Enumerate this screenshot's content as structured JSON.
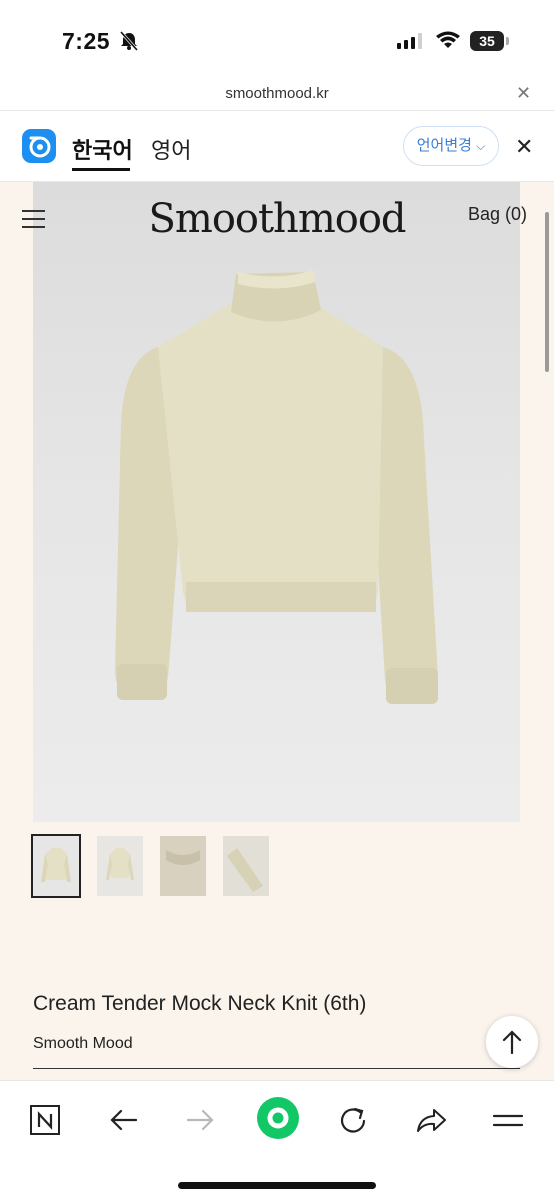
{
  "status_bar": {
    "time": "7:25",
    "battery": "35"
  },
  "browser": {
    "url": "smoothmood.kr"
  },
  "translate_bar": {
    "lang_korean": "한국어",
    "lang_english": "영어",
    "change_lang": "언어변경"
  },
  "site": {
    "logo": "Smoothmood",
    "bag": "Bag (0)"
  },
  "product": {
    "name": "Cream Tender Mock Neck Knit (6th)",
    "brand": "Smooth Mood",
    "thumbnail_count": 4,
    "selected_thumbnail": 1
  },
  "colors": {
    "accent_green": "#12c765",
    "page_bg": "#faf4ec",
    "sweater": "#e4e0c6",
    "link_blue": "#3a7fd5"
  },
  "toolbar_icons": [
    "naver-n-icon",
    "back-arrow-icon",
    "forward-arrow-icon",
    "green-home-icon",
    "reload-icon",
    "share-icon",
    "menu-icon"
  ]
}
